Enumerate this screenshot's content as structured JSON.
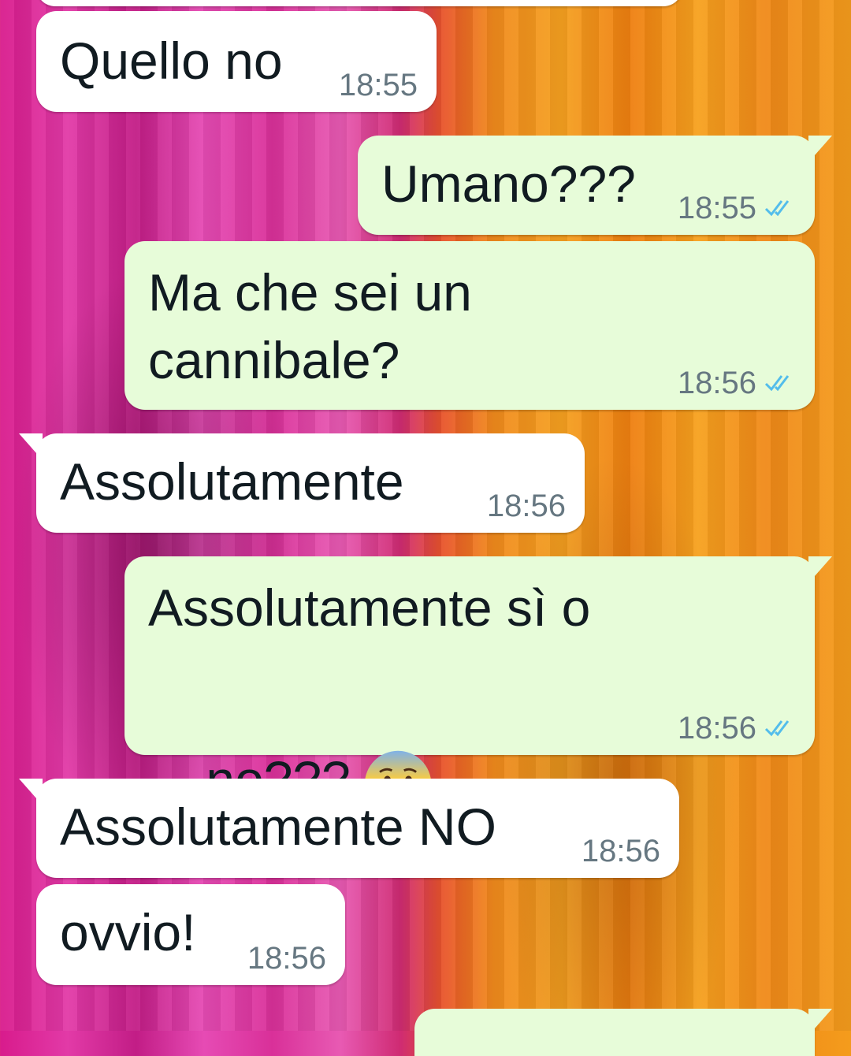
{
  "messages": [
    {
      "text": "Quello no",
      "time": "18:55"
    },
    {
      "text": "Umano???",
      "time": "18:55",
      "read_icon": "double-check-icon"
    },
    {
      "line1": "Ma che sei un",
      "line2": "cannibale?",
      "time": "18:56",
      "read_icon": "double-check-icon"
    },
    {
      "text": "Assolutamente",
      "time": "18:56"
    },
    {
      "line1": "Assolutamente sì o",
      "line2": "no???",
      "emoji": "anxious-face-with-sweat-icon",
      "time": "18:56",
      "read_icon": "double-check-icon"
    },
    {
      "text": "Assolutamente NO",
      "time": "18:56"
    },
    {
      "text": "ovvio!",
      "time": "18:56"
    }
  ],
  "colors": {
    "incoming_bubble": "#ffffff",
    "outgoing_bubble": "#e7fcd9",
    "read_ticks": "#53bdeb",
    "timestamp": "#667781"
  }
}
